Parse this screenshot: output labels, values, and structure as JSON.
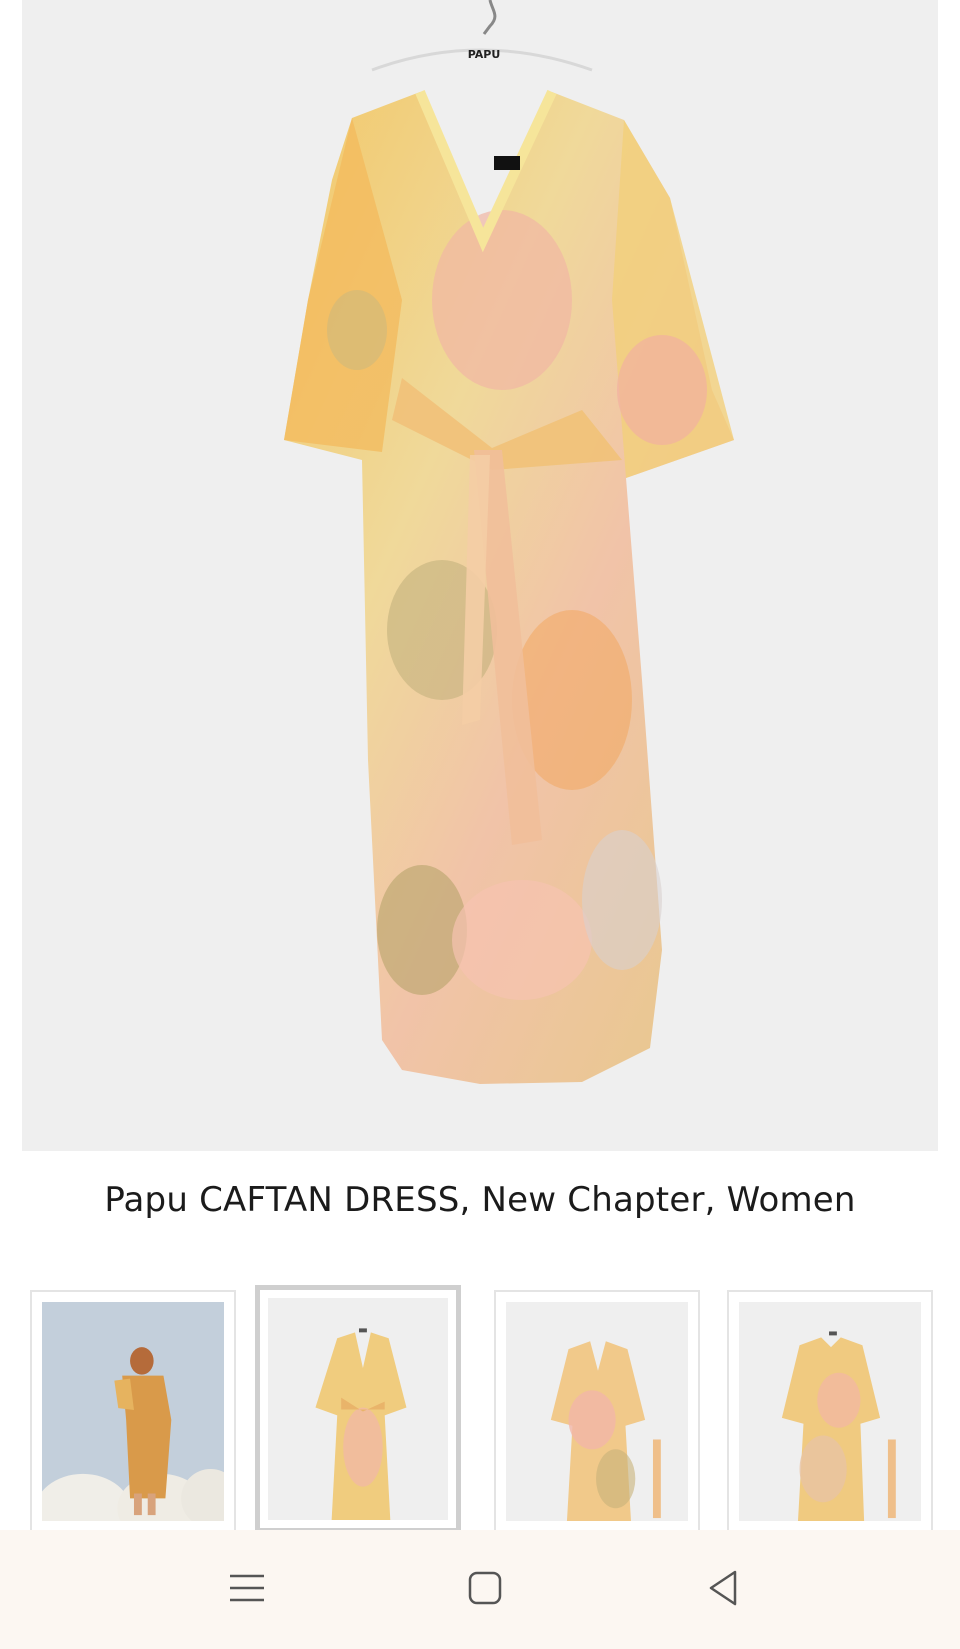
{
  "product": {
    "title": "Papu CAFTAN DRESS, New Chapter, Women",
    "hanger_logo": "PAPU",
    "image_icon": "dress-image"
  },
  "thumbnails": [
    {
      "label": "model-back-view",
      "selected": false
    },
    {
      "label": "dress-front-with-belt",
      "selected": true
    },
    {
      "label": "dress-front-belt-aside",
      "selected": false
    },
    {
      "label": "dress-back-belt-aside",
      "selected": false
    }
  ],
  "navbar": {
    "menu_icon": "menu-icon",
    "home_icon": "home-icon",
    "back_icon": "back-icon"
  },
  "colors": {
    "background": "#ffffff",
    "image_bg": "#efefef",
    "navbar_bg": "#fcf7f2",
    "selected_border": "#cfcfcf"
  }
}
